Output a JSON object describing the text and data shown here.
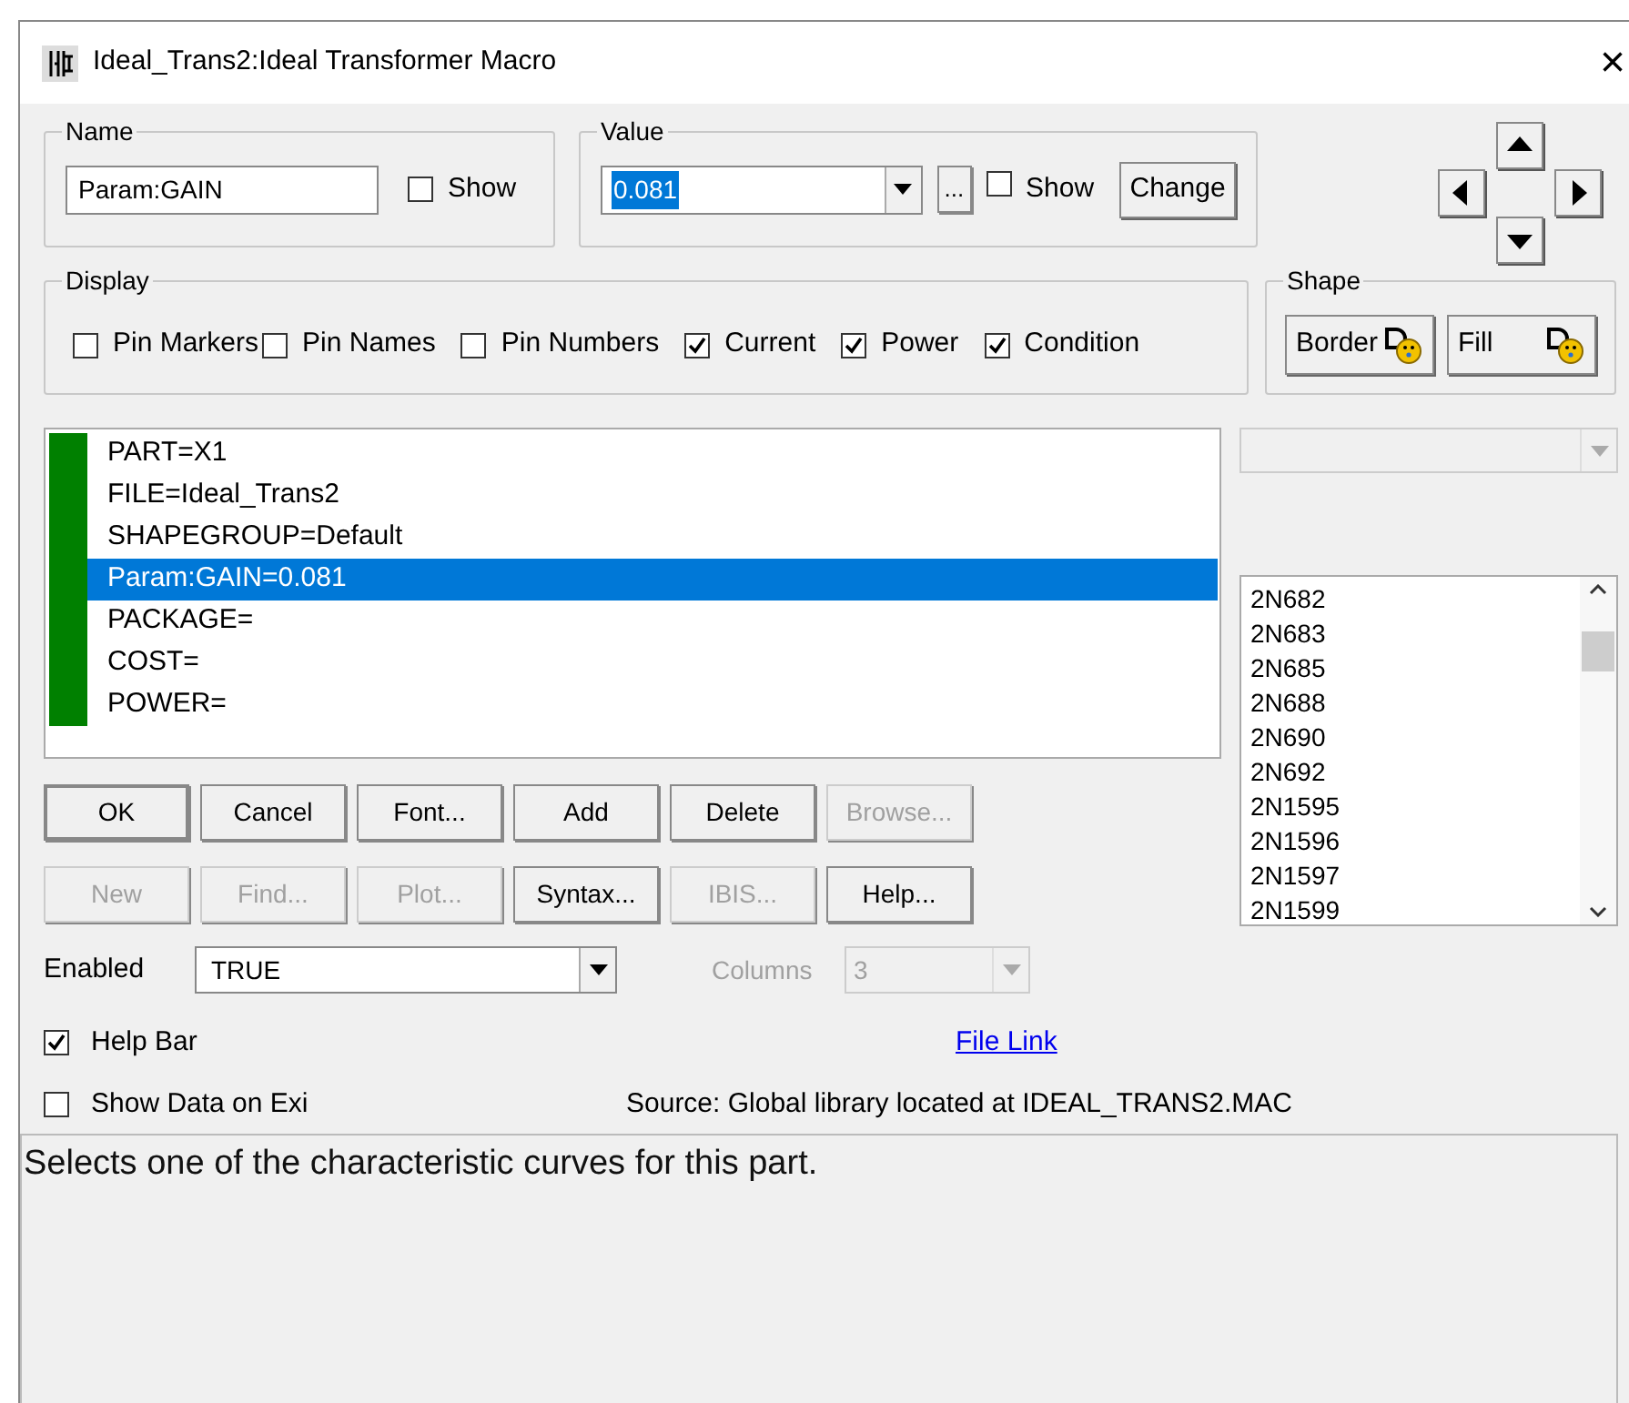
{
  "window": {
    "title": "Ideal_Trans2:Ideal Transformer Macro",
    "close": "×"
  },
  "name_group": {
    "label": "Name",
    "value": "Param:GAIN",
    "show": {
      "label": "Show",
      "checked": false
    }
  },
  "value_group": {
    "label": "Value",
    "value": "0.081",
    "browse": "...",
    "show": {
      "label": "Show",
      "checked": false
    },
    "change": "Change"
  },
  "display": {
    "label": "Display",
    "options": [
      {
        "label": "Pin Markers",
        "checked": false
      },
      {
        "label": "Pin Names",
        "checked": false
      },
      {
        "label": "Pin Numbers",
        "checked": false
      },
      {
        "label": "Current",
        "checked": true
      },
      {
        "label": "Power",
        "checked": true
      },
      {
        "label": "Condition",
        "checked": true
      }
    ]
  },
  "shape": {
    "label": "Shape",
    "buttons": [
      "Border",
      "Fill"
    ]
  },
  "attributes": [
    {
      "text": "PART=X1",
      "selected": false
    },
    {
      "text": "FILE=Ideal_Trans2",
      "selected": false
    },
    {
      "text": "SHAPEGROUP=Default",
      "selected": false
    },
    {
      "text": "Param:GAIN=0.081",
      "selected": true
    },
    {
      "text": "PACKAGE=",
      "selected": false
    },
    {
      "text": "COST=",
      "selected": false
    },
    {
      "text": "POWER=",
      "selected": false
    }
  ],
  "part_list": [
    "2N682",
    "2N683",
    "2N685",
    "2N688",
    "2N690",
    "2N692",
    "2N1595",
    "2N1596",
    "2N1597",
    "2N1599"
  ],
  "button_rows": [
    [
      {
        "label": "OK",
        "disabled": false,
        "default": true
      },
      {
        "label": "Cancel",
        "disabled": false,
        "default": false
      },
      {
        "label": "Font...",
        "disabled": false,
        "default": false
      },
      {
        "label": "Add",
        "disabled": false,
        "default": false
      },
      {
        "label": "Delete",
        "disabled": false,
        "default": false
      },
      {
        "label": "Browse...",
        "disabled": true,
        "default": false
      }
    ],
    [
      {
        "label": "New",
        "disabled": true,
        "default": false
      },
      {
        "label": "Find...",
        "disabled": true,
        "default": false
      },
      {
        "label": "Plot...",
        "disabled": true,
        "default": false
      },
      {
        "label": "Syntax...",
        "disabled": false,
        "default": false
      },
      {
        "label": "IBIS...",
        "disabled": true,
        "default": false
      },
      {
        "label": "Help...",
        "disabled": false,
        "default": false
      }
    ]
  ],
  "enabled": {
    "label": "Enabled",
    "value": "TRUE"
  },
  "columns": {
    "label": "Columns",
    "value": "3",
    "disabled": true
  },
  "help_bar": {
    "label": "Help Bar",
    "checked": true
  },
  "file_link": "File Link",
  "show_data": {
    "label": "Show Data on Exi",
    "checked": false
  },
  "source": "Source: Global library located at IDEAL_TRANS2.MAC",
  "help_text": "Selects one of the characteristic curves for this part."
}
